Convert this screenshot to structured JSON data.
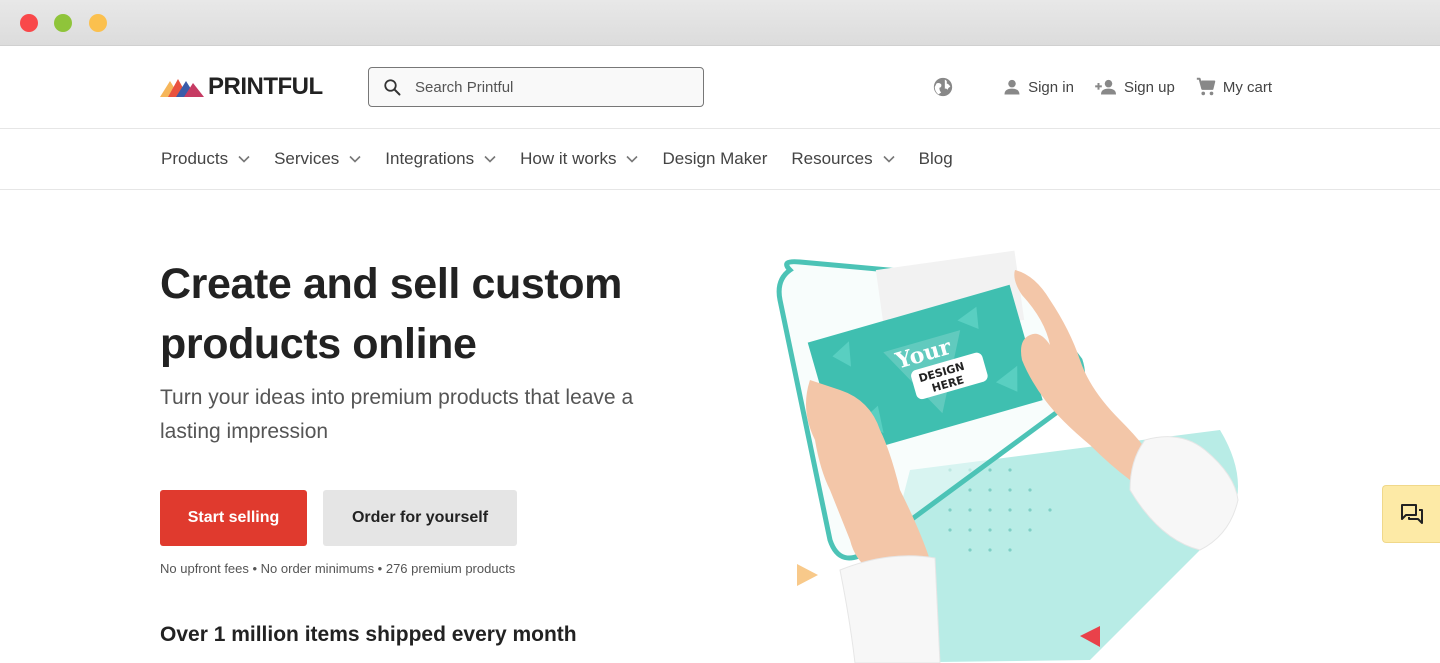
{
  "header": {
    "logo_text": "PRINTFUL",
    "search_placeholder": "Search Printful",
    "sign_in": "Sign in",
    "sign_up": "Sign up",
    "cart": "My cart"
  },
  "nav": {
    "products": "Products",
    "services": "Services",
    "integrations": "Integrations",
    "how_it_works": "How it works",
    "design_maker": "Design Maker",
    "resources": "Resources",
    "blog": "Blog"
  },
  "hero": {
    "title": "Create and sell custom products online",
    "subtitle": "Turn your ideas into premium products that leave a lasting impression",
    "primary_cta": "Start selling",
    "secondary_cta": "Order for yourself",
    "fine_print": "No upfront fees • No order minimums • 276 premium products",
    "stat": "Over 1 million items shipped every month",
    "card_text_1": "Your",
    "card_text_2": "DESIGN",
    "card_text_3": "HERE"
  },
  "colors": {
    "accent": "#e03a2e",
    "teal": "#3fbfb0",
    "chat_bg": "#fdeaa6"
  },
  "icons": {
    "search": "search-icon",
    "globe": "globe-icon",
    "user": "user-icon",
    "add_user": "add-user-icon",
    "cart": "cart-icon",
    "chat": "chat-icon"
  }
}
